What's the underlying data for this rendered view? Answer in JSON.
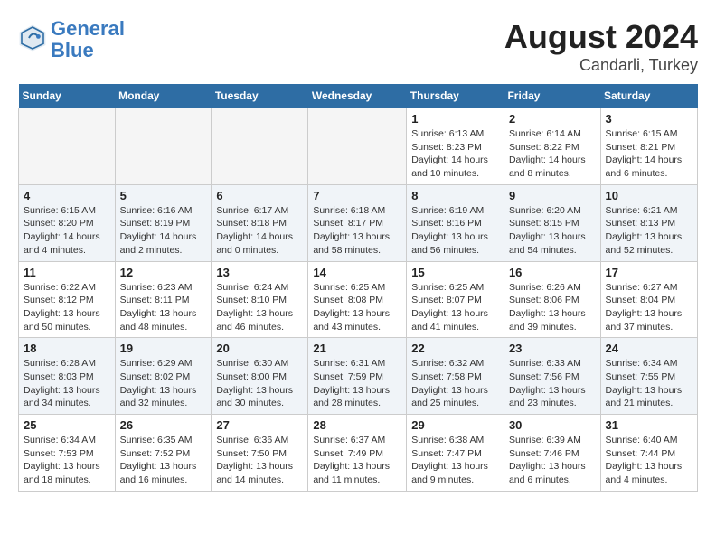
{
  "logo": {
    "line1": "General",
    "line2": "Blue"
  },
  "title": "August 2024",
  "subtitle": "Candarli, Turkey",
  "days_of_week": [
    "Sunday",
    "Monday",
    "Tuesday",
    "Wednesday",
    "Thursday",
    "Friday",
    "Saturday"
  ],
  "weeks": [
    [
      {
        "day": "",
        "empty": true
      },
      {
        "day": "",
        "empty": true
      },
      {
        "day": "",
        "empty": true
      },
      {
        "day": "",
        "empty": true
      },
      {
        "day": "1",
        "info": "Sunrise: 6:13 AM\nSunset: 8:23 PM\nDaylight: 14 hours\nand 10 minutes."
      },
      {
        "day": "2",
        "info": "Sunrise: 6:14 AM\nSunset: 8:22 PM\nDaylight: 14 hours\nand 8 minutes."
      },
      {
        "day": "3",
        "info": "Sunrise: 6:15 AM\nSunset: 8:21 PM\nDaylight: 14 hours\nand 6 minutes."
      }
    ],
    [
      {
        "day": "4",
        "info": "Sunrise: 6:15 AM\nSunset: 8:20 PM\nDaylight: 14 hours\nand 4 minutes."
      },
      {
        "day": "5",
        "info": "Sunrise: 6:16 AM\nSunset: 8:19 PM\nDaylight: 14 hours\nand 2 minutes."
      },
      {
        "day": "6",
        "info": "Sunrise: 6:17 AM\nSunset: 8:18 PM\nDaylight: 14 hours\nand 0 minutes."
      },
      {
        "day": "7",
        "info": "Sunrise: 6:18 AM\nSunset: 8:17 PM\nDaylight: 13 hours\nand 58 minutes."
      },
      {
        "day": "8",
        "info": "Sunrise: 6:19 AM\nSunset: 8:16 PM\nDaylight: 13 hours\nand 56 minutes."
      },
      {
        "day": "9",
        "info": "Sunrise: 6:20 AM\nSunset: 8:15 PM\nDaylight: 13 hours\nand 54 minutes."
      },
      {
        "day": "10",
        "info": "Sunrise: 6:21 AM\nSunset: 8:13 PM\nDaylight: 13 hours\nand 52 minutes."
      }
    ],
    [
      {
        "day": "11",
        "info": "Sunrise: 6:22 AM\nSunset: 8:12 PM\nDaylight: 13 hours\nand 50 minutes."
      },
      {
        "day": "12",
        "info": "Sunrise: 6:23 AM\nSunset: 8:11 PM\nDaylight: 13 hours\nand 48 minutes."
      },
      {
        "day": "13",
        "info": "Sunrise: 6:24 AM\nSunset: 8:10 PM\nDaylight: 13 hours\nand 46 minutes."
      },
      {
        "day": "14",
        "info": "Sunrise: 6:25 AM\nSunset: 8:08 PM\nDaylight: 13 hours\nand 43 minutes."
      },
      {
        "day": "15",
        "info": "Sunrise: 6:25 AM\nSunset: 8:07 PM\nDaylight: 13 hours\nand 41 minutes."
      },
      {
        "day": "16",
        "info": "Sunrise: 6:26 AM\nSunset: 8:06 PM\nDaylight: 13 hours\nand 39 minutes."
      },
      {
        "day": "17",
        "info": "Sunrise: 6:27 AM\nSunset: 8:04 PM\nDaylight: 13 hours\nand 37 minutes."
      }
    ],
    [
      {
        "day": "18",
        "info": "Sunrise: 6:28 AM\nSunset: 8:03 PM\nDaylight: 13 hours\nand 34 minutes."
      },
      {
        "day": "19",
        "info": "Sunrise: 6:29 AM\nSunset: 8:02 PM\nDaylight: 13 hours\nand 32 minutes."
      },
      {
        "day": "20",
        "info": "Sunrise: 6:30 AM\nSunset: 8:00 PM\nDaylight: 13 hours\nand 30 minutes."
      },
      {
        "day": "21",
        "info": "Sunrise: 6:31 AM\nSunset: 7:59 PM\nDaylight: 13 hours\nand 28 minutes."
      },
      {
        "day": "22",
        "info": "Sunrise: 6:32 AM\nSunset: 7:58 PM\nDaylight: 13 hours\nand 25 minutes."
      },
      {
        "day": "23",
        "info": "Sunrise: 6:33 AM\nSunset: 7:56 PM\nDaylight: 13 hours\nand 23 minutes."
      },
      {
        "day": "24",
        "info": "Sunrise: 6:34 AM\nSunset: 7:55 PM\nDaylight: 13 hours\nand 21 minutes."
      }
    ],
    [
      {
        "day": "25",
        "info": "Sunrise: 6:34 AM\nSunset: 7:53 PM\nDaylight: 13 hours\nand 18 minutes."
      },
      {
        "day": "26",
        "info": "Sunrise: 6:35 AM\nSunset: 7:52 PM\nDaylight: 13 hours\nand 16 minutes."
      },
      {
        "day": "27",
        "info": "Sunrise: 6:36 AM\nSunset: 7:50 PM\nDaylight: 13 hours\nand 14 minutes."
      },
      {
        "day": "28",
        "info": "Sunrise: 6:37 AM\nSunset: 7:49 PM\nDaylight: 13 hours\nand 11 minutes."
      },
      {
        "day": "29",
        "info": "Sunrise: 6:38 AM\nSunset: 7:47 PM\nDaylight: 13 hours\nand 9 minutes."
      },
      {
        "day": "30",
        "info": "Sunrise: 6:39 AM\nSunset: 7:46 PM\nDaylight: 13 hours\nand 6 minutes."
      },
      {
        "day": "31",
        "info": "Sunrise: 6:40 AM\nSunset: 7:44 PM\nDaylight: 13 hours\nand 4 minutes."
      }
    ]
  ],
  "alt_rows": [
    1,
    3
  ]
}
